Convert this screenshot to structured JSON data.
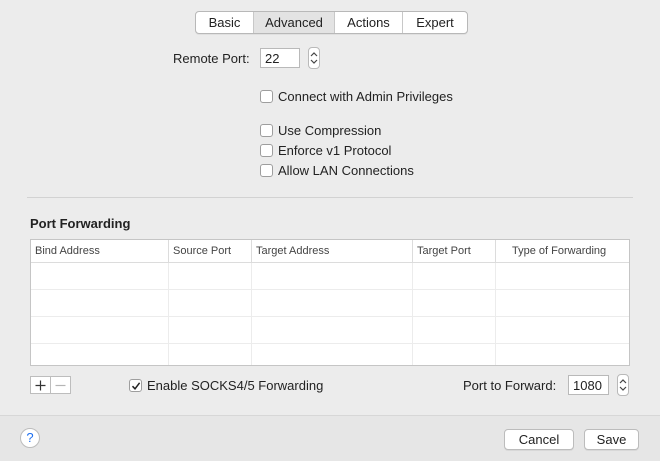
{
  "tabs": [
    {
      "label": "Basic",
      "active": false
    },
    {
      "label": "Advanced",
      "active": true
    },
    {
      "label": "Actions",
      "active": false
    },
    {
      "label": "Expert",
      "active": false
    }
  ],
  "remote_port": {
    "label": "Remote Port:",
    "value": "22"
  },
  "options": {
    "admin_privileges": {
      "label": "Connect with Admin Privileges",
      "checked": false
    },
    "compression": {
      "label": "Use Compression",
      "checked": false
    },
    "enforce_v1": {
      "label": "Enforce v1 Protocol",
      "checked": false
    },
    "allow_lan": {
      "label": "Allow LAN Connections",
      "checked": false
    }
  },
  "port_forwarding": {
    "title": "Port Forwarding",
    "columns": [
      "Bind Address",
      "Source Port",
      "Target Address",
      "Target Port",
      "Type of Forwarding"
    ],
    "rows": []
  },
  "socks": {
    "label": "Enable SOCKS4/5 Forwarding",
    "checked": true
  },
  "port_to_forward": {
    "label": "Port to Forward:",
    "value": "1080"
  },
  "footer": {
    "help": "?",
    "cancel": "Cancel",
    "save": "Save"
  },
  "icons": {
    "add": "plus-icon",
    "remove": "minus-icon",
    "stepper": "stepper-arrows-icon",
    "check": "checkmark-icon"
  }
}
